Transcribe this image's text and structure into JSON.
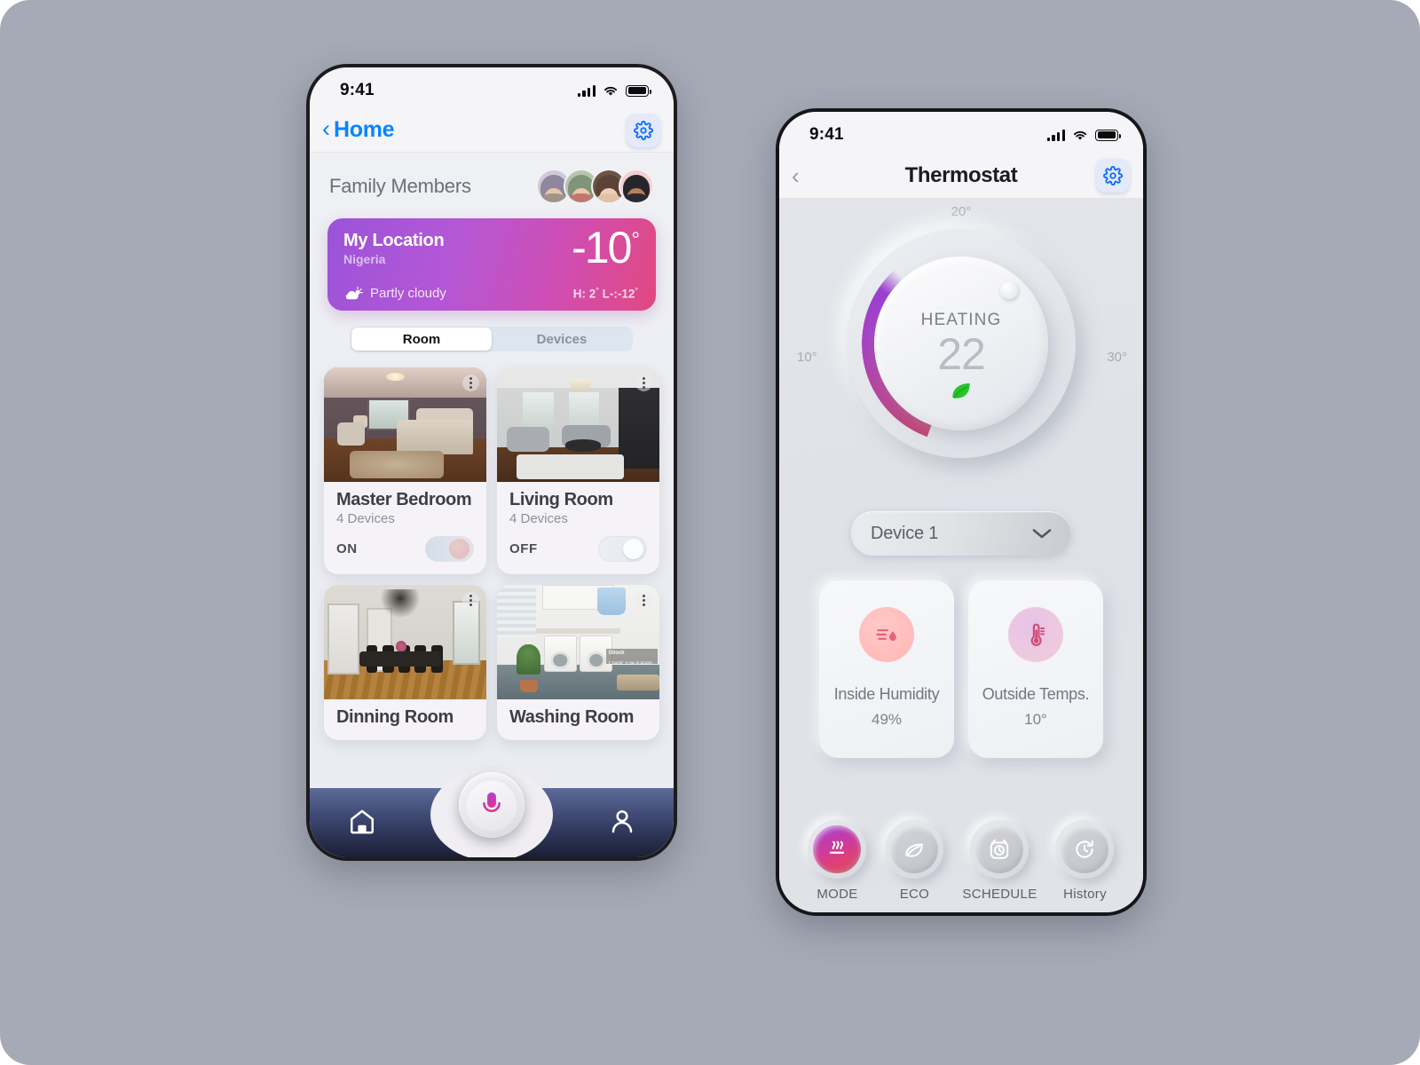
{
  "home": {
    "status": {
      "time": "9:41",
      "signal_icon": "signal-bars-icon",
      "wifi_icon": "wifi-icon",
      "battery_icon": "battery-icon"
    },
    "nav": {
      "back_icon": "back-chevron-icon",
      "title": "Home",
      "settings_icon": "gear-icon"
    },
    "family": {
      "title": "Family Members",
      "members": [
        "avatar-1",
        "avatar-2",
        "avatar-3",
        "avatar-4"
      ]
    },
    "weather": {
      "location": "My Location",
      "country": "Nigeria",
      "temp": "-10",
      "degree": "°",
      "condition": "Partly cloudy",
      "condition_icon": "partly-cloudy-icon",
      "high_low": "H: 2",
      "high_low_mid": " L-:-12",
      "gradient_from": "#9b53d8",
      "gradient_to": "#e2487f"
    },
    "tabs": [
      {
        "label": "Room",
        "active": true
      },
      {
        "label": "Devices",
        "active": false
      }
    ],
    "rooms": [
      {
        "name": "Master Bedroom",
        "devices": "4 Devices",
        "state": "ON",
        "on": true,
        "menu_icon": "more-options-icon"
      },
      {
        "name": "Living Room",
        "devices": "4 Devices",
        "state": "OFF",
        "on": false,
        "menu_icon": "more-options-icon"
      },
      {
        "name": "Dinning Room",
        "devices": "",
        "state": "",
        "on": false,
        "menu_icon": "more-options-icon"
      },
      {
        "name": "Washing Room",
        "devices": "",
        "state": "",
        "on": false,
        "menu_icon": "more-options-icon"
      }
    ],
    "washing_credit": {
      "line1": "iStock",
      "line2": "Credit: Eve Katalin"
    },
    "bottom_nav": {
      "home_icon": "home-icon",
      "mic_icon": "microphone-icon",
      "profile_icon": "person-icon"
    }
  },
  "thermostat": {
    "status": {
      "time": "9:41",
      "signal_icon": "signal-bars-icon",
      "wifi_icon": "wifi-icon",
      "battery_icon": "battery-icon"
    },
    "nav": {
      "back_icon": "back-chevron-icon",
      "title": "Thermostat",
      "settings_icon": "gear-icon"
    },
    "dial": {
      "scale_top": "20°",
      "scale_left": "10°",
      "scale_right": "30°",
      "mode": "HEATING",
      "value": "22",
      "eco_icon": "leaf-icon",
      "handle_icon": "dial-handle",
      "arc_from": "#c4416b",
      "arc_to": "#9b3fd0"
    },
    "device_select": {
      "value": "Device 1",
      "chevron_icon": "chevron-down-icon"
    },
    "info_cards": [
      {
        "label": "Inside Humidity",
        "value": "49%",
        "icon": "humidity-icon"
      },
      {
        "label": "Outside Temps.",
        "value": "10°",
        "icon": "thermometer-icon"
      }
    ],
    "actions": [
      {
        "label": "MODE",
        "icon": "heat-waves-icon",
        "active": true
      },
      {
        "label": "ECO",
        "icon": "leaf-icon",
        "active": false
      },
      {
        "label": "SCHEDULE",
        "icon": "alarm-clock-icon",
        "active": false
      },
      {
        "label": "History",
        "icon": "history-icon",
        "active": false
      }
    ]
  }
}
